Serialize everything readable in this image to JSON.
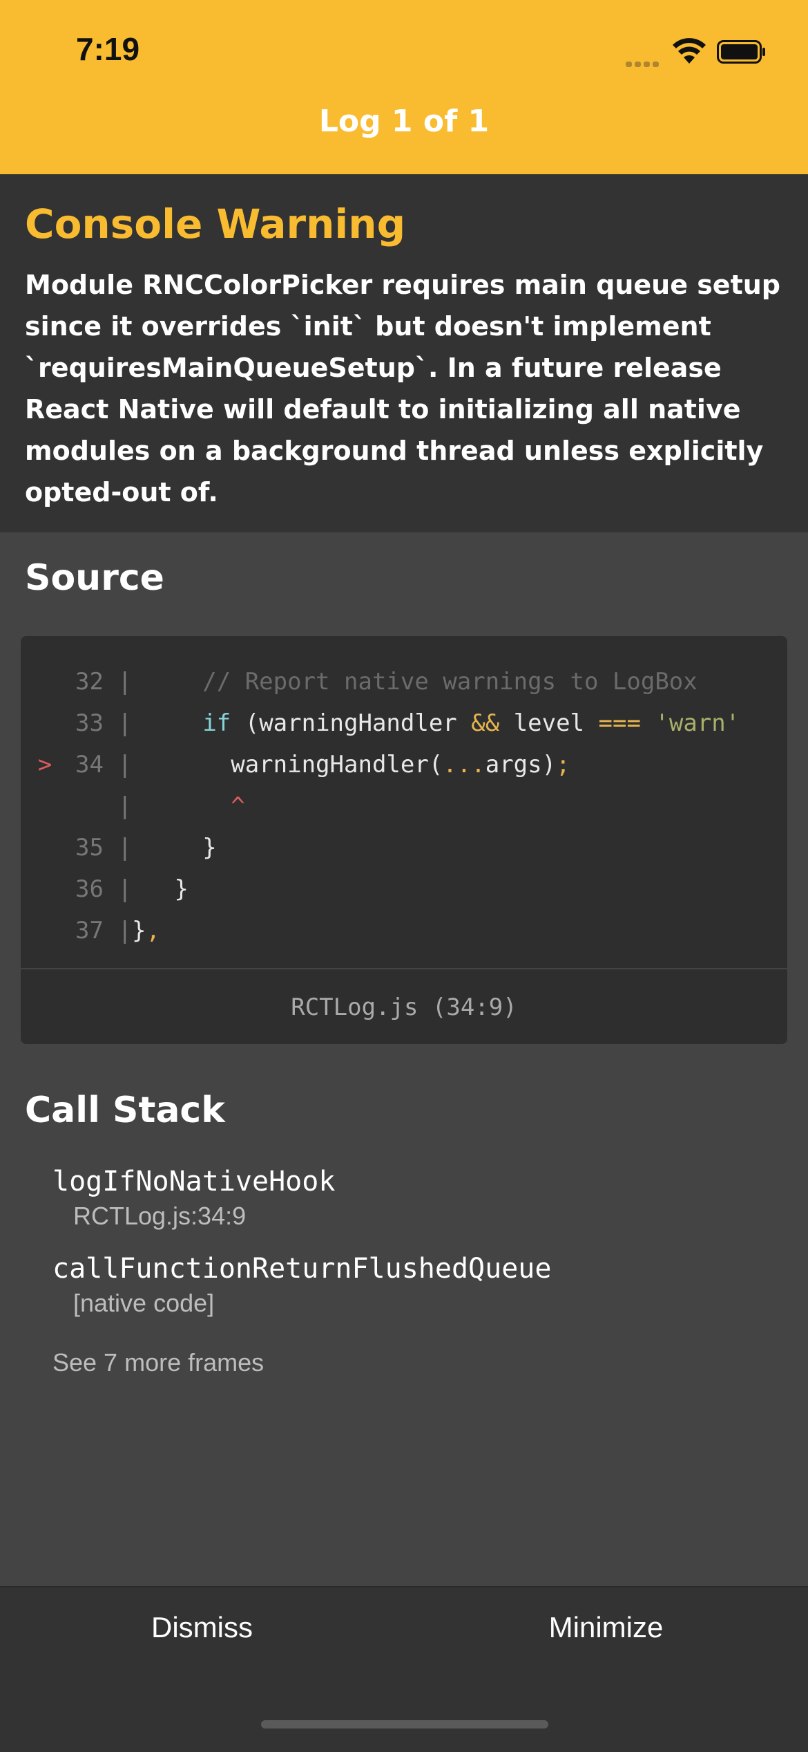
{
  "status_bar": {
    "time": "7:19",
    "icons": [
      "cellular-signal-icon",
      "wifi-icon",
      "battery-icon"
    ]
  },
  "header": {
    "title": "Log 1 of 1",
    "background": "#F9BB30"
  },
  "warning": {
    "heading": "Console Warning",
    "message": "Module RNCColorPicker requires main queue setup since it overrides `init` but doesn't implement `requiresMainQueueSetup`. In a future release React Native will default to initializing all native modules on a background thread unless explicitly opted-out of.",
    "accent": "#F9BB30"
  },
  "source": {
    "title": "Source",
    "lines": [
      {
        "marker": "",
        "number": "32",
        "code": "    // Report native warnings to LogBox"
      },
      {
        "marker": "",
        "number": "33",
        "code": "    if (warningHandler && level === 'warn'"
      },
      {
        "marker": ">",
        "number": "34",
        "code": "      warningHandler(...args);"
      },
      {
        "marker": "",
        "number": "",
        "code": "      ^"
      },
      {
        "marker": "",
        "number": "35",
        "code": "    }"
      },
      {
        "marker": "",
        "number": "36",
        "code": "  }"
      },
      {
        "marker": "",
        "number": "37",
        "code": "},"
      }
    ],
    "file_location": "RCTLog.js (34:9)"
  },
  "call_stack": {
    "title": "Call Stack",
    "frames": [
      {
        "name": "logIfNoNativeHook",
        "location": "RCTLog.js:34:9"
      },
      {
        "name": "callFunctionReturnFlushedQueue",
        "location": "[native code]"
      }
    ],
    "more_frames": "See 7 more frames"
  },
  "footer": {
    "dismiss_label": "Dismiss",
    "minimize_label": "Minimize"
  }
}
